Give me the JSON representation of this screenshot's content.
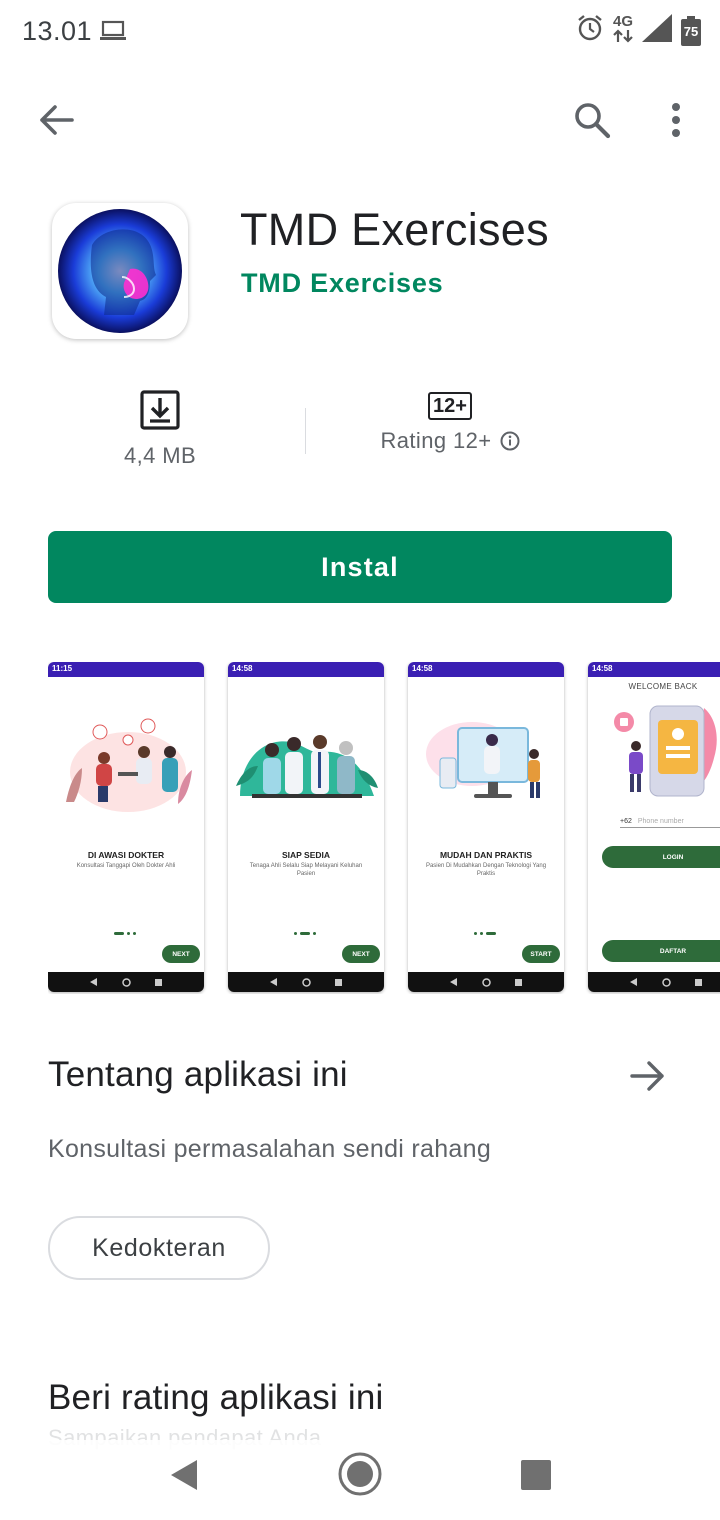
{
  "status_bar": {
    "time": "13.01",
    "network": "4G",
    "battery": "75"
  },
  "app": {
    "title": "TMD Exercises",
    "developer": "TMD Exercises"
  },
  "stats": {
    "size": "4,4 MB",
    "age_badge": "12+",
    "rating_label": "Rating 12+"
  },
  "install_label": "Instal",
  "screenshots": [
    {
      "status_time": "11:15",
      "title": "DI AWASI DOKTER",
      "subtitle": "Konsultasi Tanggapi Oleh Dokter Ahli",
      "button": "NEXT"
    },
    {
      "status_time": "14:58",
      "title": "SIAP SEDIA",
      "subtitle": "Tenaga Ahli Selalu Siap Melayani Keluhan Pasien",
      "button": "NEXT"
    },
    {
      "status_time": "14:58",
      "title": "MUDAH DAN PRAKTIS",
      "subtitle": "Pasien Di Mudahkan Dengan Teknologi Yang Praktis",
      "button": "START"
    },
    {
      "status_time": "14:58",
      "welcome": "WELCOME BACK",
      "country_code": "+62",
      "phone_placeholder": "Phone number",
      "login": "LOGIN",
      "register": "DAFTAR"
    }
  ],
  "about": {
    "title": "Tentang aplikasi ini",
    "description": "Konsultasi permasalahan sendi rahang",
    "category": "Kedokteran"
  },
  "rate": {
    "title": "Beri rating aplikasi ini",
    "subtitle": "Sampaikan pendapat Anda"
  },
  "colors": {
    "accent": "#01875f",
    "shot_status": "#3a1fb3",
    "shot_button": "#2e6b3a"
  },
  "icons": [
    "laptop-icon",
    "alarm-icon",
    "signal-icon",
    "battery-icon",
    "back-arrow-icon",
    "search-icon",
    "more-vert-icon",
    "download-icon",
    "info-icon",
    "arrow-forward-icon",
    "nav-back-icon",
    "nav-home-icon",
    "nav-recent-icon"
  ]
}
